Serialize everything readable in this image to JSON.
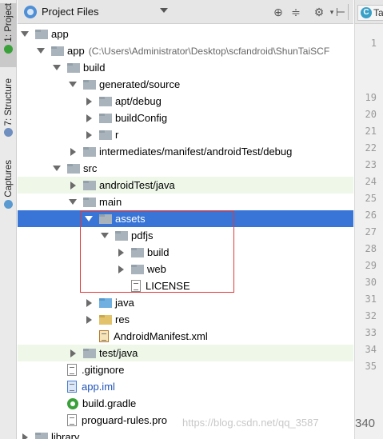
{
  "side_tabs": [
    {
      "label": "1: Project",
      "active": true
    },
    {
      "label": "7: Structure",
      "active": false
    },
    {
      "label": "Captures",
      "active": false
    }
  ],
  "header": {
    "title": "Project Files",
    "toolbar_icons": [
      "sync-icon",
      "collapse-icon",
      "settings-icon",
      "hide-icon"
    ]
  },
  "editor": {
    "tab_label": "Ta",
    "line_numbers": [
      "1",
      "19",
      "20",
      "21",
      "22",
      "23",
      "24",
      "25",
      "26",
      "27",
      "28",
      "29",
      "30",
      "31",
      "32",
      "33",
      "34",
      "35"
    ]
  },
  "tree": {
    "rows": [
      {
        "label": "app",
        "depth": 0,
        "arrow": "down",
        "icon": "folder-gray"
      },
      {
        "label": "app",
        "path": "(C:\\Users\\Administrator\\Desktop\\scfandroid\\ShunTaiSCF",
        "depth": 1,
        "arrow": "down",
        "icon": "folder-gray"
      },
      {
        "label": "build",
        "depth": 2,
        "arrow": "down",
        "icon": "folder-gray"
      },
      {
        "label": "generated/source",
        "depth": 3,
        "arrow": "down",
        "icon": "folder-gray"
      },
      {
        "label": "apt/debug",
        "depth": 4,
        "arrow": "right",
        "icon": "folder-gray"
      },
      {
        "label": "buildConfig",
        "depth": 4,
        "arrow": "right",
        "icon": "folder-gray"
      },
      {
        "label": "r",
        "depth": 4,
        "arrow": "right",
        "icon": "folder-gray"
      },
      {
        "label": "intermediates/manifest/androidTest/debug",
        "depth": 3,
        "arrow": "right",
        "icon": "folder-gray"
      },
      {
        "label": "src",
        "depth": 2,
        "arrow": "down",
        "icon": "folder-gray"
      },
      {
        "label": "androidTest/java",
        "depth": 3,
        "arrow": "right",
        "icon": "folder-gray",
        "highlight": "green"
      },
      {
        "label": "main",
        "depth": 3,
        "arrow": "down",
        "icon": "folder-gray"
      },
      {
        "label": "assets",
        "depth": 4,
        "arrow": "down",
        "icon": "folder-gray",
        "selected": true
      },
      {
        "label": "pdfjs",
        "depth": 5,
        "arrow": "down",
        "icon": "folder-gray"
      },
      {
        "label": "build",
        "depth": 6,
        "arrow": "right",
        "icon": "folder-gray"
      },
      {
        "label": "web",
        "depth": 6,
        "arrow": "right",
        "icon": "folder-gray"
      },
      {
        "label": "LICENSE",
        "depth": 6,
        "arrow": "none",
        "icon": "file-text"
      },
      {
        "label": "java",
        "depth": 4,
        "arrow": "right",
        "icon": "folder-blue"
      },
      {
        "label": "res",
        "depth": 4,
        "arrow": "right",
        "icon": "folder-yellow"
      },
      {
        "label": "AndroidManifest.xml",
        "depth": 4,
        "arrow": "none",
        "icon": "file-xml"
      },
      {
        "label": "test/java",
        "depth": 3,
        "arrow": "right",
        "icon": "folder-gray",
        "highlight": "green"
      },
      {
        "label": ".gitignore",
        "depth": 2,
        "arrow": "none",
        "icon": "file-text"
      },
      {
        "label": "app.iml",
        "depth": 2,
        "arrow": "none",
        "icon": "file-iml",
        "label_color": "blue"
      },
      {
        "label": "build.gradle",
        "depth": 2,
        "arrow": "none",
        "icon": "gradle"
      },
      {
        "label": "proguard-rules.pro",
        "depth": 2,
        "arrow": "none",
        "icon": "file-text"
      },
      {
        "label": "library",
        "depth": 0,
        "arrow": "right",
        "icon": "folder-gray"
      }
    ]
  },
  "watermark": "https://blog.csdn.net/qq_3587",
  "watermark_suffix": "340"
}
